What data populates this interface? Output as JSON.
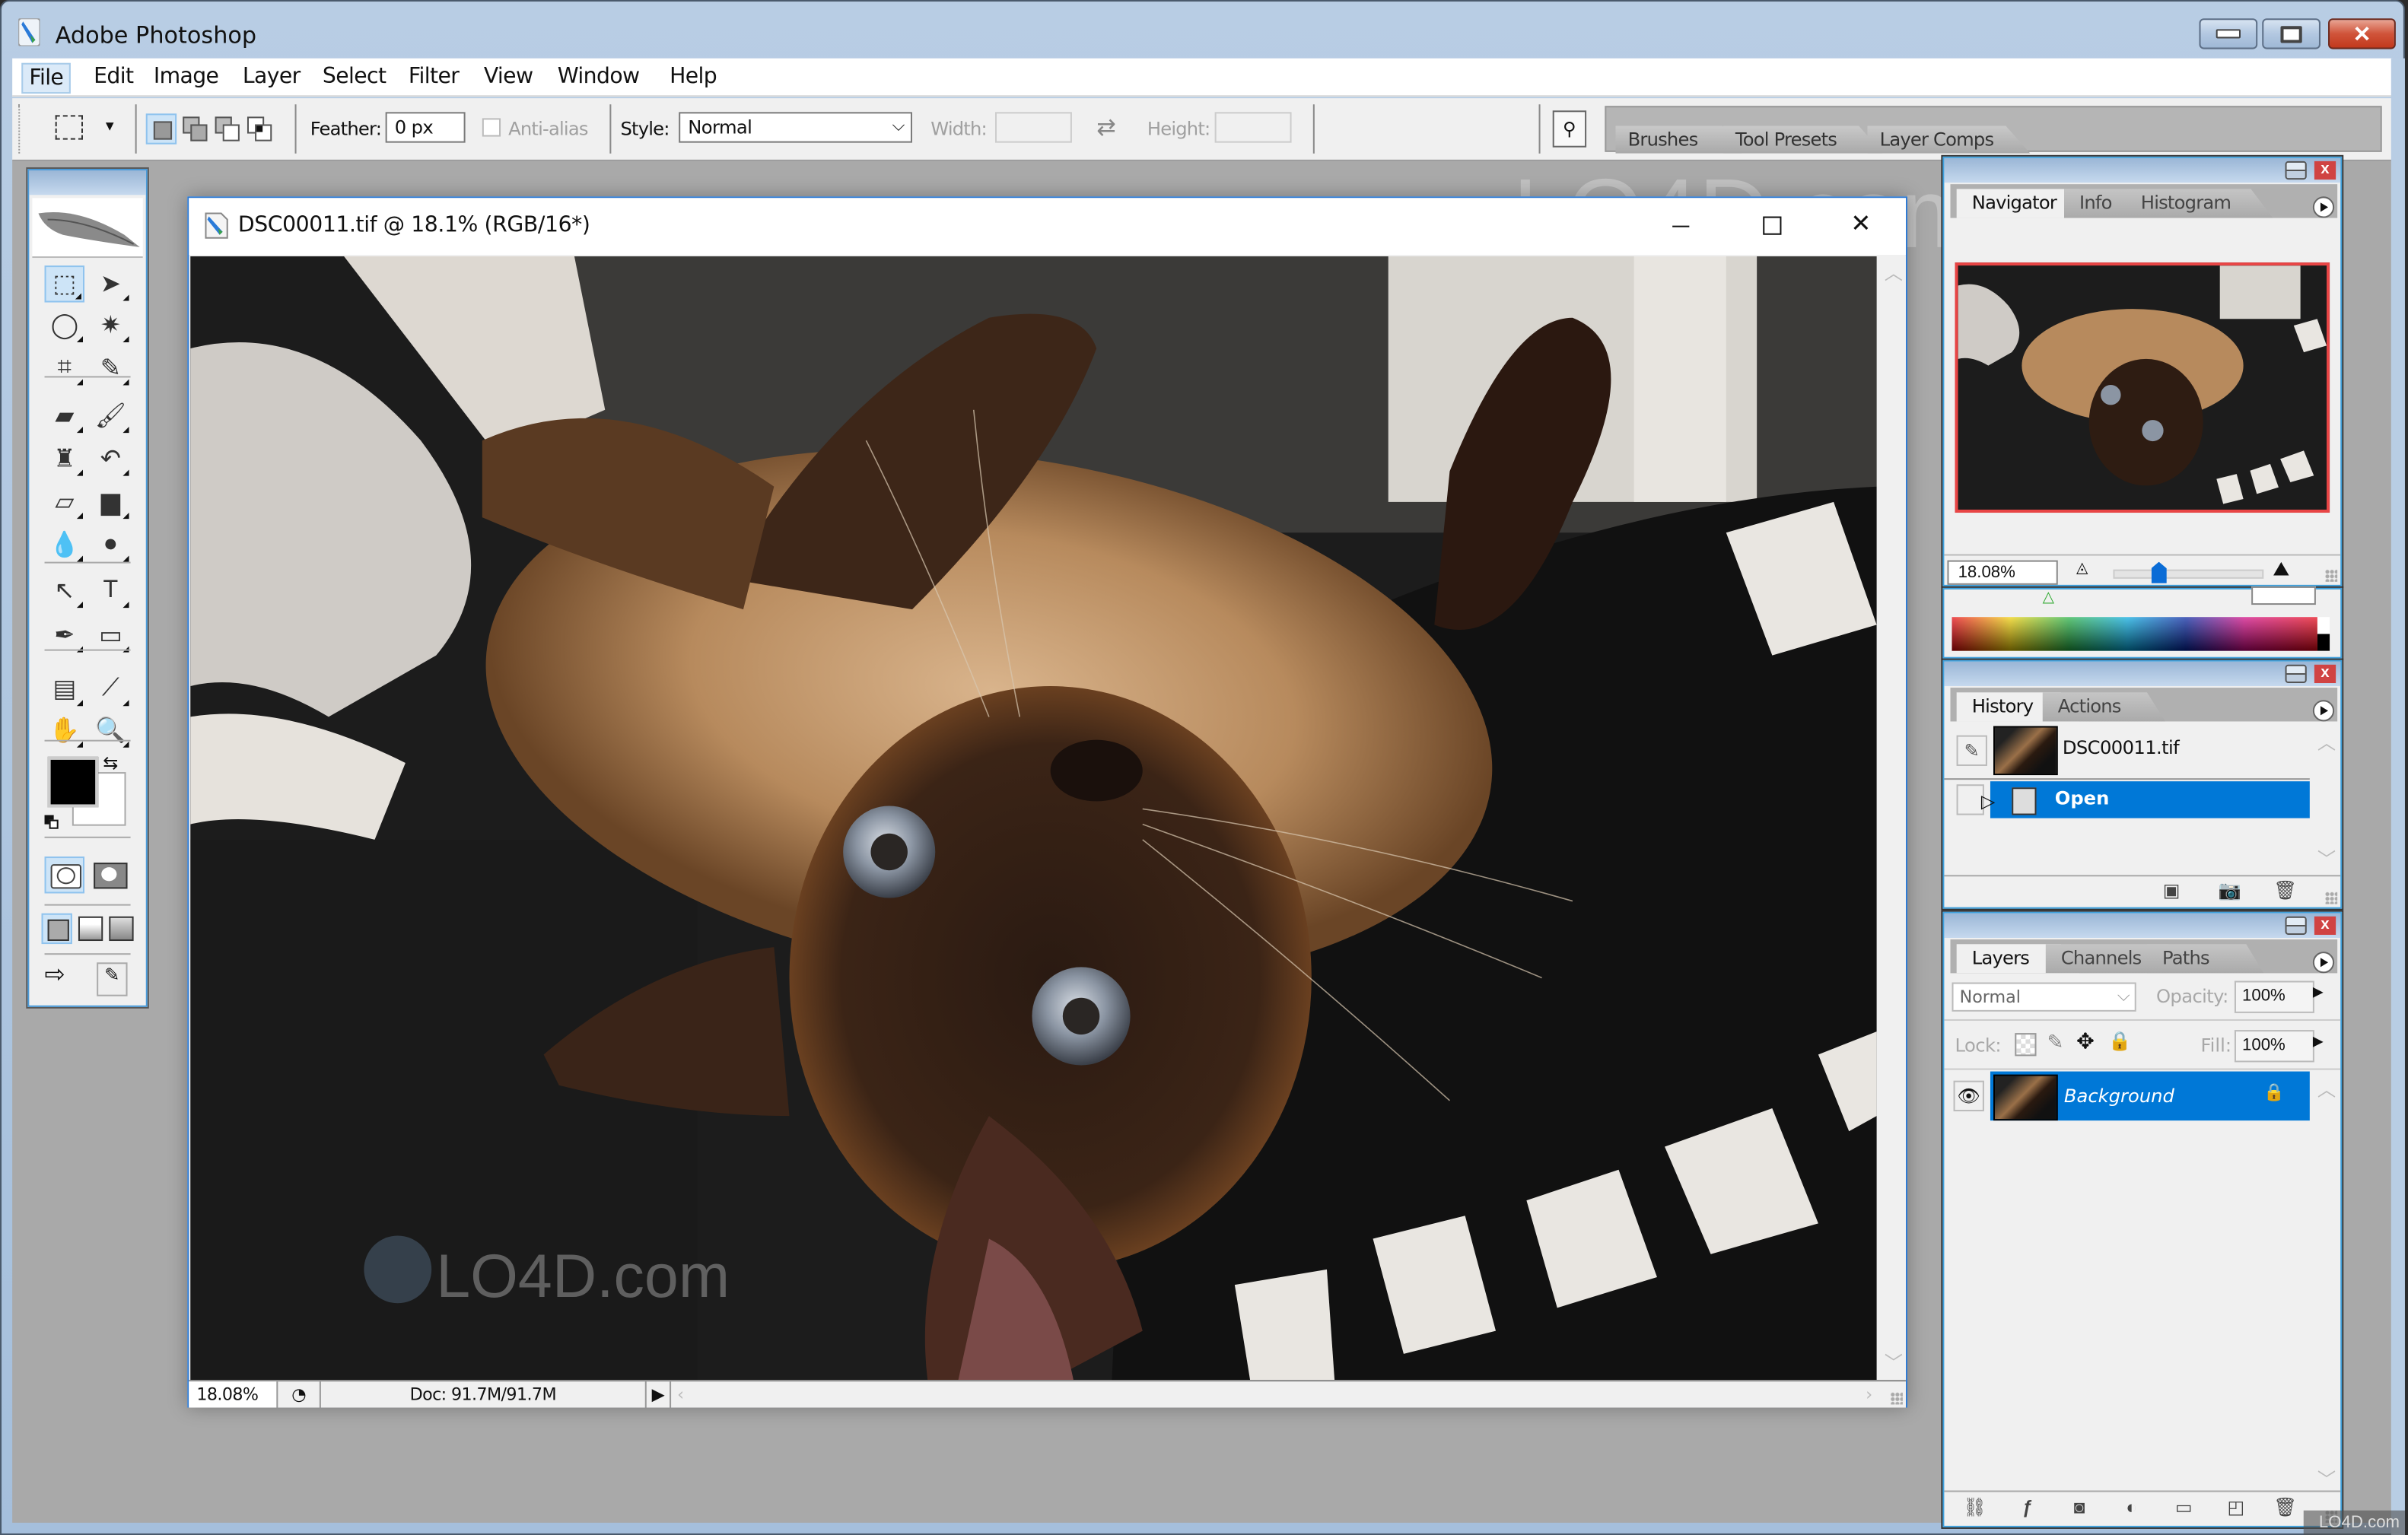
{
  "app": {
    "title": "Adobe Photoshop",
    "window_controls": {
      "minimize": "—",
      "maximize": "□",
      "close": "✕"
    }
  },
  "menubar": {
    "items": [
      {
        "label": "File",
        "active": true
      },
      {
        "label": "Edit"
      },
      {
        "label": "Image"
      },
      {
        "label": "Layer"
      },
      {
        "label": "Select"
      },
      {
        "label": "Filter"
      },
      {
        "label": "View"
      },
      {
        "label": "Window"
      },
      {
        "label": "Help"
      }
    ]
  },
  "options_bar": {
    "tool_icon": "rect-marquee-icon",
    "selection_modes": [
      "new-selection",
      "add-to-selection",
      "subtract-from-selection",
      "intersect-selection"
    ],
    "feather_label": "Feather:",
    "feather_value": "0 px",
    "antialias_label": "Anti-alias",
    "antialias_checked": false,
    "style_label": "Style:",
    "style_value": "Normal",
    "width_label": "Width:",
    "width_value": "",
    "swap_icon": "⇄",
    "height_label": "Height:",
    "height_value": "",
    "file_browser_icon": "file-browser-icon"
  },
  "palette_well": {
    "tabs": [
      "Brushes",
      "Tool Presets",
      "Layer Comps"
    ]
  },
  "toolbox": {
    "tools": [
      {
        "name": "rectangular-marquee",
        "glyph": "⬚",
        "selected": true
      },
      {
        "name": "move",
        "glyph": "➤"
      },
      {
        "name": "lasso",
        "glyph": "◯"
      },
      {
        "name": "magic-wand",
        "glyph": "✷"
      },
      {
        "name": "crop",
        "glyph": "⌗"
      },
      {
        "name": "slice",
        "glyph": "✎"
      },
      {
        "name": "healing-brush",
        "glyph": "▰"
      },
      {
        "name": "brush",
        "glyph": "🖌"
      },
      {
        "name": "clone-stamp",
        "glyph": "♜"
      },
      {
        "name": "history-brush",
        "glyph": "↶"
      },
      {
        "name": "eraser",
        "glyph": "▱"
      },
      {
        "name": "gradient",
        "glyph": "▆"
      },
      {
        "name": "blur",
        "glyph": "💧"
      },
      {
        "name": "dodge",
        "glyph": "●"
      },
      {
        "name": "path-selection",
        "glyph": "↖"
      },
      {
        "name": "type",
        "glyph": "T"
      },
      {
        "name": "pen",
        "glyph": "✒"
      },
      {
        "name": "shape",
        "glyph": "▭"
      },
      {
        "name": "notes",
        "glyph": "▤"
      },
      {
        "name": "eyedropper",
        "glyph": "⟋"
      },
      {
        "name": "hand",
        "glyph": "✋"
      },
      {
        "name": "zoom",
        "glyph": "🔍"
      }
    ],
    "foreground_color": "#000000",
    "background_color": "#ffffff",
    "swap_glyph": "⇆"
  },
  "document": {
    "title": "DSC00011.tif @ 18.1% (RGB/16*)",
    "zoom": "18.08%",
    "doc_size": "Doc: 91.7M/91.7M",
    "watermark": "LO4D.com"
  },
  "navigator_panel": {
    "tabs": [
      "Navigator",
      "Info",
      "Histogram"
    ],
    "active_tab": "Navigator",
    "zoom_value": "18.08%",
    "zoom_slider_fraction": 0.3
  },
  "history_panel": {
    "tabs": [
      "History",
      "Actions"
    ],
    "active_tab": "History",
    "snapshot": "DSC00011.tif",
    "states": [
      {
        "label": "Open",
        "selected": true
      }
    ]
  },
  "layers_panel": {
    "tabs": [
      "Layers",
      "Channels",
      "Paths"
    ],
    "active_tab": "Layers",
    "blend_mode": "Normal",
    "opacity_label": "Opacity:",
    "opacity_value": "100%",
    "lock_label": "Lock:",
    "fill_label": "Fill:",
    "fill_value": "100%",
    "layers": [
      {
        "name": "Background",
        "visible": true,
        "locked": true,
        "selected": true
      }
    ]
  },
  "accent_colors": {
    "selection_blue": "#0078d7",
    "panel_close_red": "#d04343",
    "navigator_view_box": "#e84545"
  }
}
